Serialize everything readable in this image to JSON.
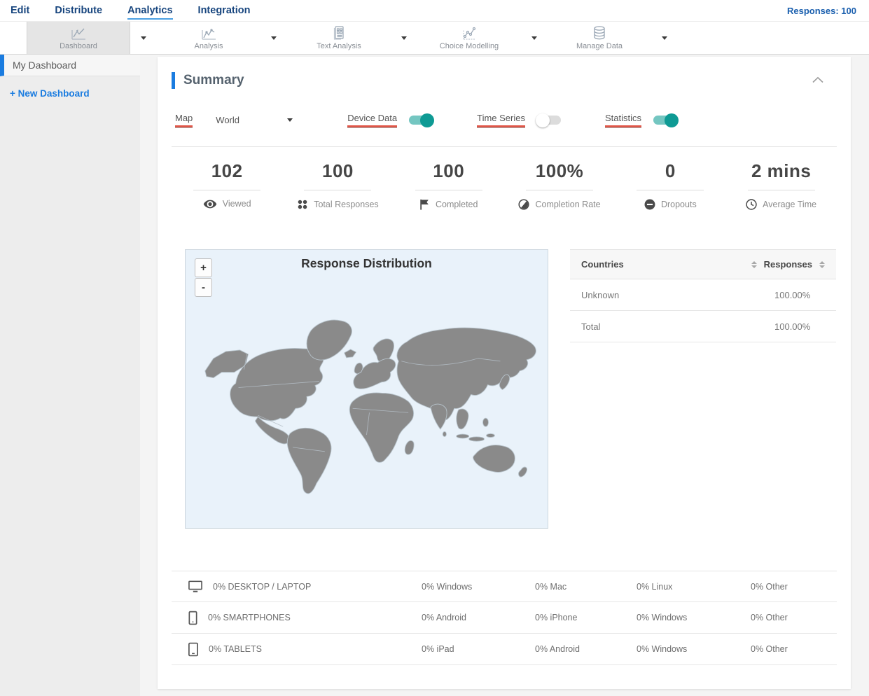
{
  "colors": {
    "accent_blue": "#1a7ce0",
    "nav_blue": "#17457e",
    "toggle_on_teal": "#0e9a94",
    "underline_red": "#df5648",
    "map_land": "#8a8a8a",
    "map_bg": "#e9f2fa"
  },
  "nav": {
    "items": [
      {
        "label": "Edit",
        "active": false
      },
      {
        "label": "Distribute",
        "active": false
      },
      {
        "label": "Analytics",
        "active": true
      },
      {
        "label": "Integration",
        "active": false
      }
    ],
    "responses_label": "Responses: 100"
  },
  "toolbar": {
    "items": [
      {
        "label": "Dashboard",
        "icon": "line-chart-icon",
        "active": true
      },
      {
        "label": "Analysis",
        "icon": "line-chart-icon",
        "active": false
      },
      {
        "label": "Text Analysis",
        "icon": "document-grid-icon",
        "active": false
      },
      {
        "label": "Choice Modelling",
        "icon": "scatter-chart-icon",
        "active": false
      },
      {
        "label": "Manage Data",
        "icon": "database-icon",
        "active": false
      }
    ]
  },
  "sidebar": {
    "items": [
      {
        "label": "My Dashboard",
        "active": true
      }
    ],
    "new_dashboard_label": "+ New Dashboard"
  },
  "summary": {
    "title": "Summary",
    "controls": {
      "map_label": "Map",
      "map_value": "World",
      "toggles": [
        {
          "label": "Device Data",
          "on": true
        },
        {
          "label": "Time Series",
          "on": false
        },
        {
          "label": "Statistics",
          "on": true
        }
      ]
    },
    "stats": [
      {
        "value": "102",
        "label": "Viewed",
        "icon": "eye-icon"
      },
      {
        "value": "100",
        "label": "Total Responses",
        "icon": "dots-grid-icon"
      },
      {
        "value": "100",
        "label": "Completed",
        "icon": "flag-icon"
      },
      {
        "value": "100%",
        "label": "Completion Rate",
        "icon": "half-circle-icon"
      },
      {
        "value": "0",
        "label": "Dropouts",
        "icon": "minus-circle-icon"
      },
      {
        "value": "2 mins",
        "label": "Average Time",
        "icon": "clock-icon"
      }
    ],
    "map": {
      "title": "Response Distribution",
      "zoom_in": "+",
      "zoom_out": "-"
    },
    "countries_table": {
      "columns": {
        "countries": "Countries",
        "responses": "Responses"
      },
      "rows": [
        {
          "name": "Unknown",
          "value": "100.00%"
        },
        {
          "name": "Total",
          "value": "100.00%"
        }
      ]
    },
    "devices_table": {
      "rows": [
        {
          "icon": "desktop-icon",
          "label": "0% DESKTOP / LAPTOP",
          "col1": "0% Windows",
          "col2": "0% Mac",
          "col3": "0% Linux",
          "col4": "0% Other"
        },
        {
          "icon": "smartphone-icon",
          "label": "0% SMARTPHONES",
          "col1": "0% Android",
          "col2": "0% iPhone",
          "col3": "0% Windows",
          "col4": "0% Other"
        },
        {
          "icon": "tablet-icon",
          "label": "0% TABLETS",
          "col1": "0% iPad",
          "col2": "0% Android",
          "col3": "0% Windows",
          "col4": "0% Other"
        }
      ]
    }
  }
}
